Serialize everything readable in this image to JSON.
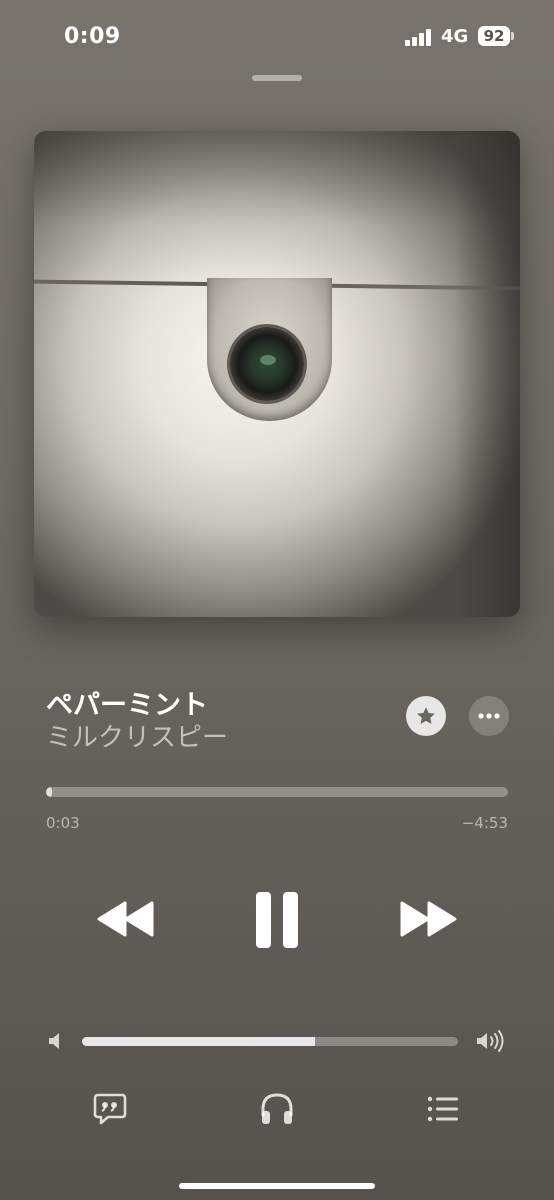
{
  "status_bar": {
    "time": "0:09",
    "network": "4G",
    "battery_level": "92",
    "signal_bars": 4
  },
  "now_playing": {
    "title": "ペパーミント",
    "artist": "ミルクリスピー",
    "elapsed": "0:03",
    "remaining": "−4:53",
    "progress_fraction": 0.01,
    "is_playing": true
  },
  "volume": {
    "level_fraction": 0.62
  },
  "icons": {
    "favorite": "star-icon",
    "more": "ellipsis-icon",
    "rewind": "rewind-icon",
    "pause": "pause-icon",
    "forward": "fast-forward-icon",
    "volume_low": "speaker-low-icon",
    "volume_high": "speaker-high-icon",
    "lyrics": "lyrics-bubble-icon",
    "output": "headphones-icon",
    "queue": "queue-list-icon"
  },
  "colors": {
    "background": "#6f6b65",
    "foreground": "#ffffff"
  }
}
